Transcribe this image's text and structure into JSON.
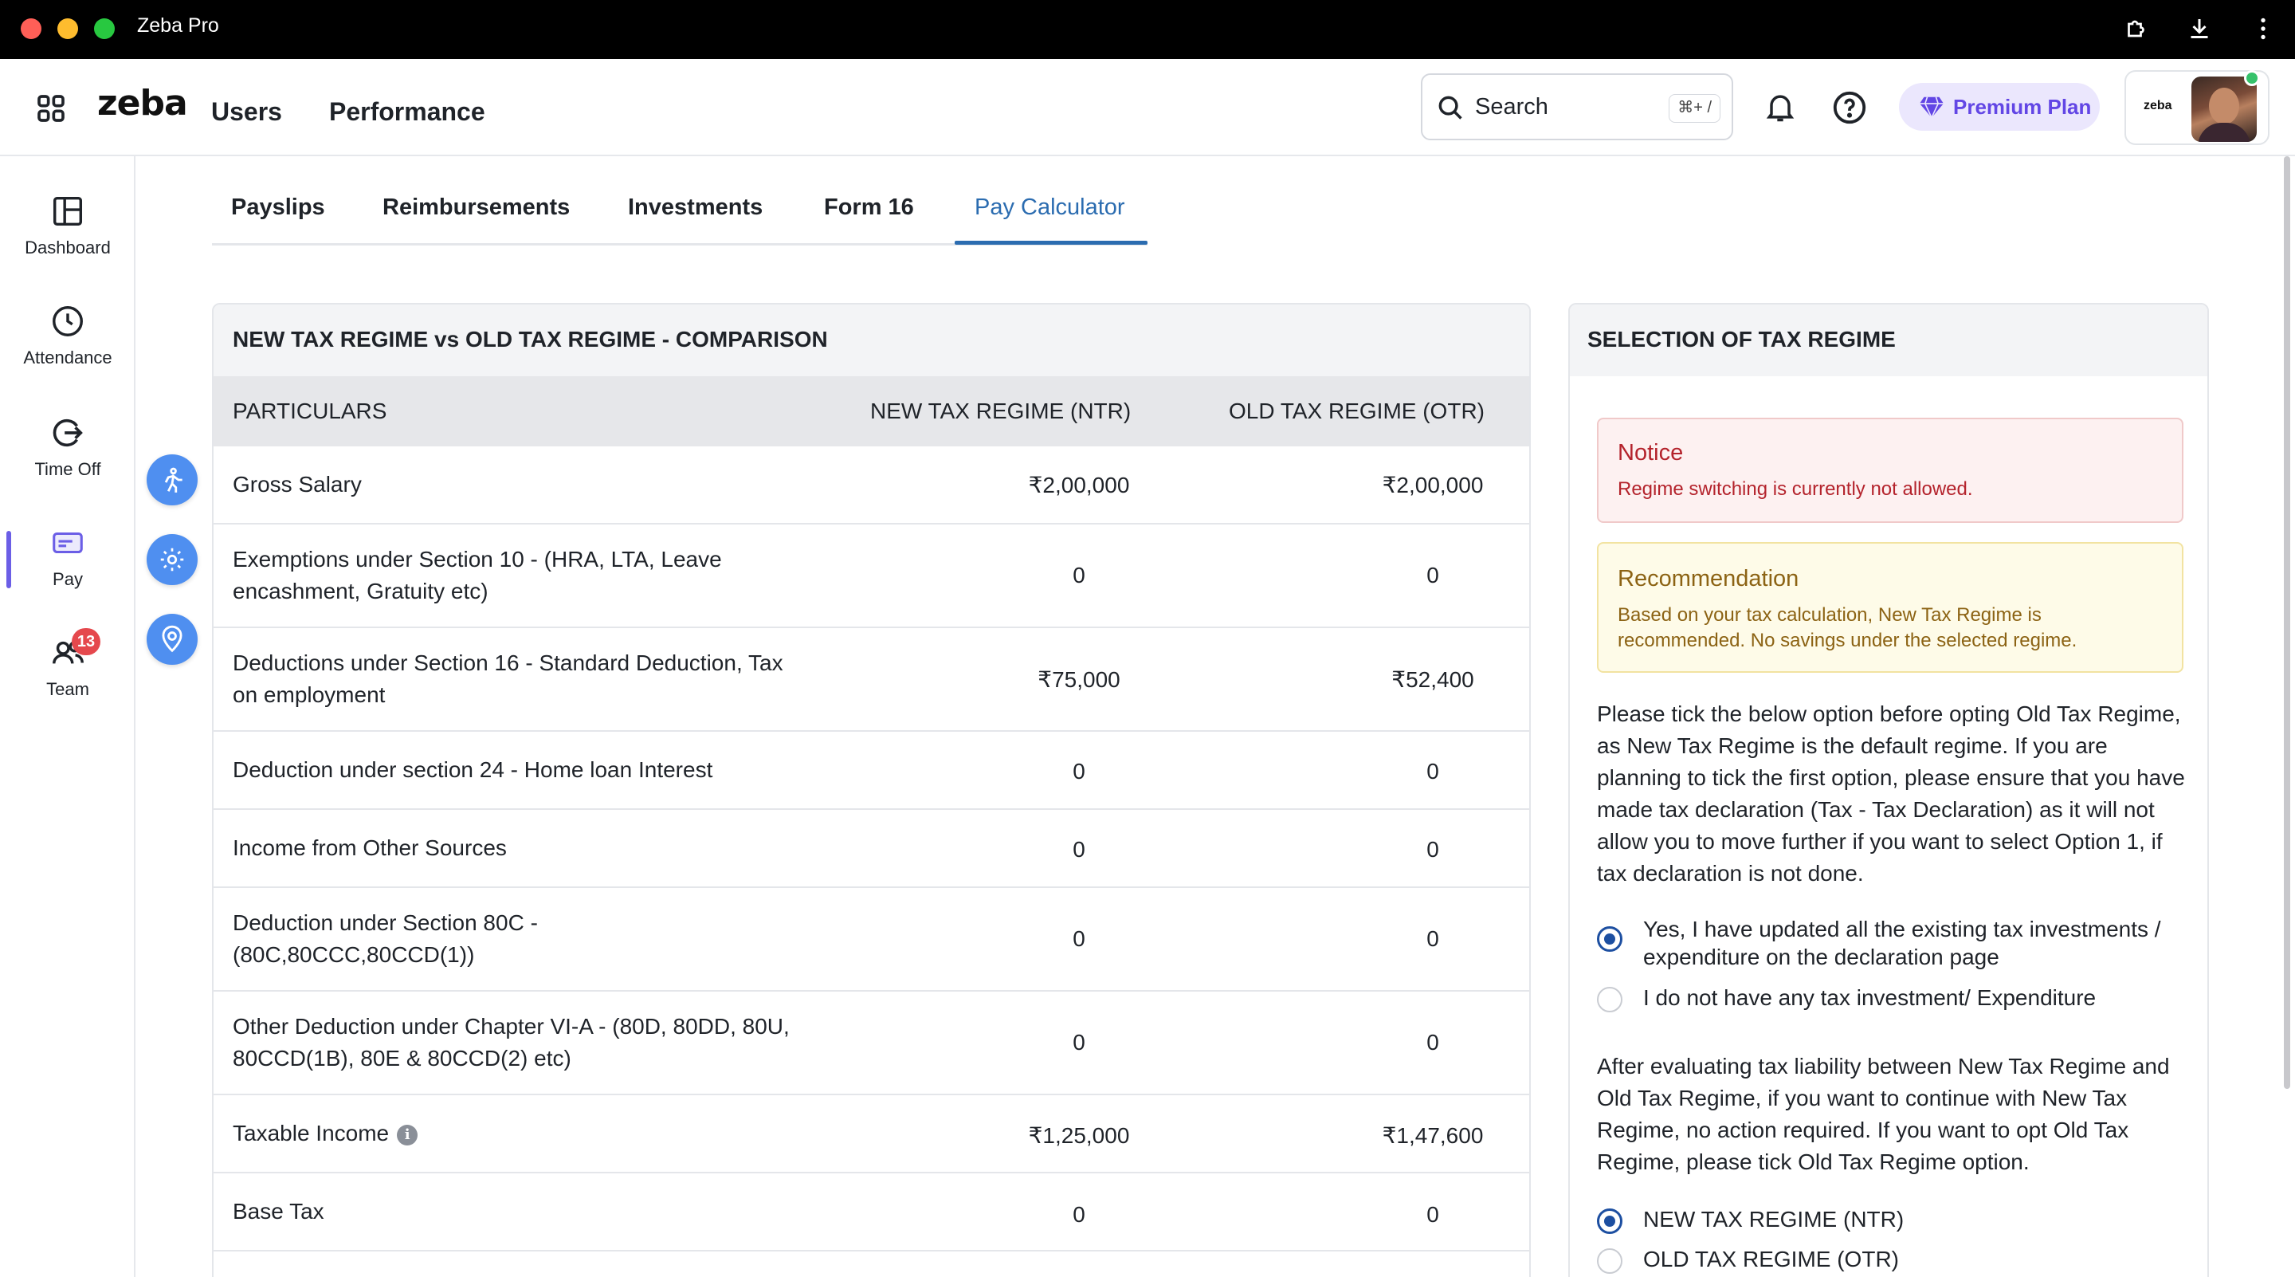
{
  "window": {
    "title": "Zeba Pro"
  },
  "header": {
    "logo": "zeba",
    "nav": [
      "Users",
      "Performance"
    ],
    "search": {
      "placeholder": "Search",
      "shortcut": "⌘+ /"
    },
    "premium_label": "Premium Plan",
    "profile_logo": "zeba"
  },
  "sidebar": {
    "items": [
      {
        "label": "Dashboard",
        "icon": "dashboard-icon"
      },
      {
        "label": "Attendance",
        "icon": "clock-icon"
      },
      {
        "label": "Time Off",
        "icon": "logout-icon"
      },
      {
        "label": "Pay",
        "icon": "wallet-icon",
        "active": true
      },
      {
        "label": "Team",
        "icon": "team-icon",
        "badge": "13"
      }
    ]
  },
  "tabs": [
    "Payslips",
    "Reimbursements",
    "Investments",
    "Form 16",
    "Pay Calculator"
  ],
  "active_tab": "Pay Calculator",
  "comparison": {
    "title": "NEW TAX REGIME vs OLD TAX REGIME - COMPARISON",
    "columns": [
      "PARTICULARS",
      "NEW TAX REGIME (NTR)",
      "OLD TAX REGIME (OTR)"
    ],
    "rows": [
      {
        "label": "Gross Salary",
        "ntr": "₹2,00,000",
        "otr": "₹2,00,000"
      },
      {
        "label": "Exemptions under Section 10 - (HRA, LTA, Leave encashment, Gratuity etc)",
        "ntr": "0",
        "otr": "0"
      },
      {
        "label": "Deductions under Section 16 - Standard Deduction, Tax on employment",
        "ntr": "₹75,000",
        "otr": "₹52,400"
      },
      {
        "label": "Deduction under section 24 - Home loan Interest",
        "ntr": "0",
        "otr": "0"
      },
      {
        "label": "Income from Other Sources",
        "ntr": "0",
        "otr": "0"
      },
      {
        "label": "Deduction under Section 80C - (80C,80CCC,80CCD(1))",
        "ntr": "0",
        "otr": "0"
      },
      {
        "label": "Other Deduction under Chapter VI-A - (80D, 80DD, 80U, 80CCD(1B), 80E & 80CCD(2) etc)",
        "ntr": "0",
        "otr": "0"
      },
      {
        "label": "Taxable Income",
        "ntr": "₹1,25,000",
        "otr": "₹1,47,600",
        "info": "i"
      },
      {
        "label": "Base Tax",
        "ntr": "0",
        "otr": "0"
      }
    ]
  },
  "selection": {
    "title": "SELECTION OF TAX REGIME",
    "notice": {
      "title": "Notice",
      "text": "Regime switching is currently not allowed."
    },
    "recommendation": {
      "title": "Recommendation",
      "text": "Based on your tax calculation, New Tax Regime is recommended. No savings under the selected regime."
    },
    "instructions": "Please tick the below option before opting Old Tax Regime, as New Tax Regime is the default regime. If you are planning to tick the first option, please ensure that you have made tax declaration (Tax - Tax Declaration) as it will not allow you to move further if you want to select Option 1, if tax declaration is not done.",
    "declaration_options": [
      {
        "label": "Yes, I have updated all the existing tax investments / expenditure on the declaration page",
        "checked": true
      },
      {
        "label": "I do not have any tax investment/ Expenditure",
        "checked": false
      }
    ],
    "evaluation_text": "After evaluating tax liability between New Tax Regime and Old Tax Regime, if you want to continue with New Tax Regime, no action required. If you want to opt Old Tax Regime, please tick Old Tax Regime option.",
    "regime_options": [
      {
        "label": "NEW TAX REGIME (NTR)",
        "checked": true
      },
      {
        "label": "OLD TAX REGIME (OTR)",
        "checked": false
      }
    ]
  },
  "colors": {
    "accent": "#2b6cb0",
    "premium": "#6246e5",
    "notice": "#b4232c",
    "recommendation": "#8c6314",
    "badge": "#e5484d"
  }
}
